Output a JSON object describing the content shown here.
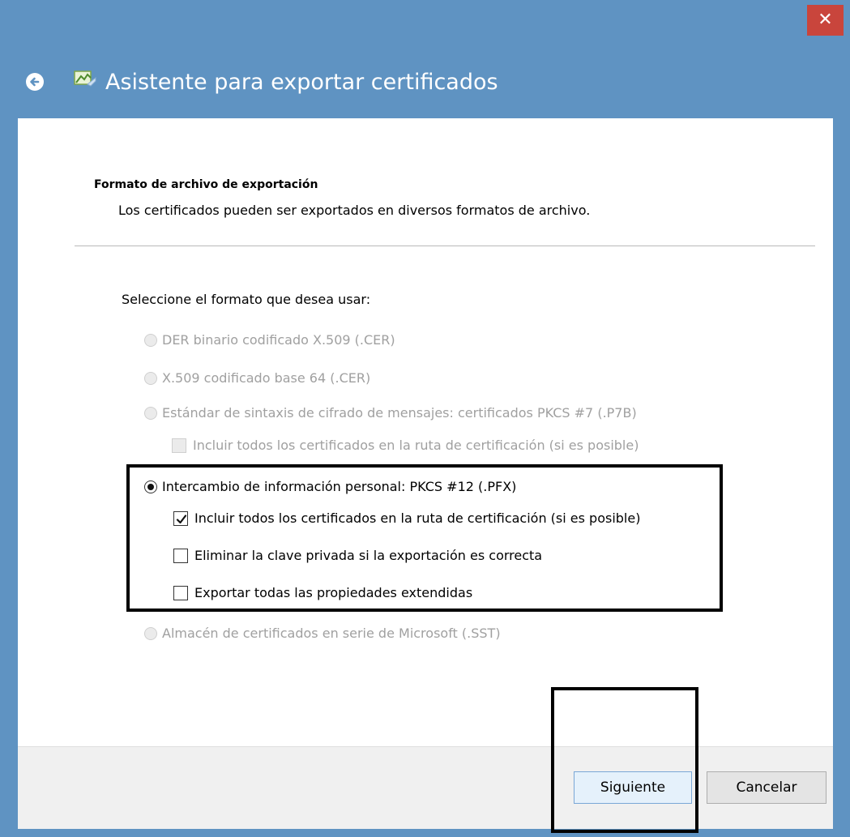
{
  "window": {
    "title": "Asistente para exportar certificados",
    "close_glyph": "✕",
    "accent_color": "#5f93c2",
    "close_color": "#c9453c"
  },
  "header": {
    "title": "Formato de archivo de exportación",
    "description": "Los certificados pueden ser exportados en diversos formatos de archivo."
  },
  "form": {
    "select_label": "Seleccione el formato que desea usar:",
    "options": [
      {
        "label": "DER binario codificado X.509 (.CER)",
        "enabled": false,
        "selected": false
      },
      {
        "label": "X.509 codificado base 64 (.CER)",
        "enabled": false,
        "selected": false
      },
      {
        "label": "Estándar de sintaxis de cifrado de mensajes: certificados PKCS #7 (.P7B)",
        "enabled": false,
        "selected": false
      },
      {
        "label": "Intercambio de información personal: PKCS #12 (.PFX)",
        "enabled": true,
        "selected": true
      },
      {
        "label": "Almacén de certificados en serie de Microsoft (.SST)",
        "enabled": false,
        "selected": false
      }
    ],
    "p7b_checkbox": {
      "label": "Incluir todos los certificados en la ruta de certificación (si es posible)",
      "checked": false,
      "enabled": false
    },
    "pfx_checkboxes": [
      {
        "label": "Incluir todos los certificados en la ruta de certificación (si es posible)",
        "checked": true
      },
      {
        "label": "Eliminar la clave privada si la exportación es correcta",
        "checked": false
      },
      {
        "label": "Exportar todas las propiedades extendidas",
        "checked": false
      }
    ]
  },
  "footer": {
    "next_label": "Siguiente",
    "cancel_label": "Cancelar"
  }
}
